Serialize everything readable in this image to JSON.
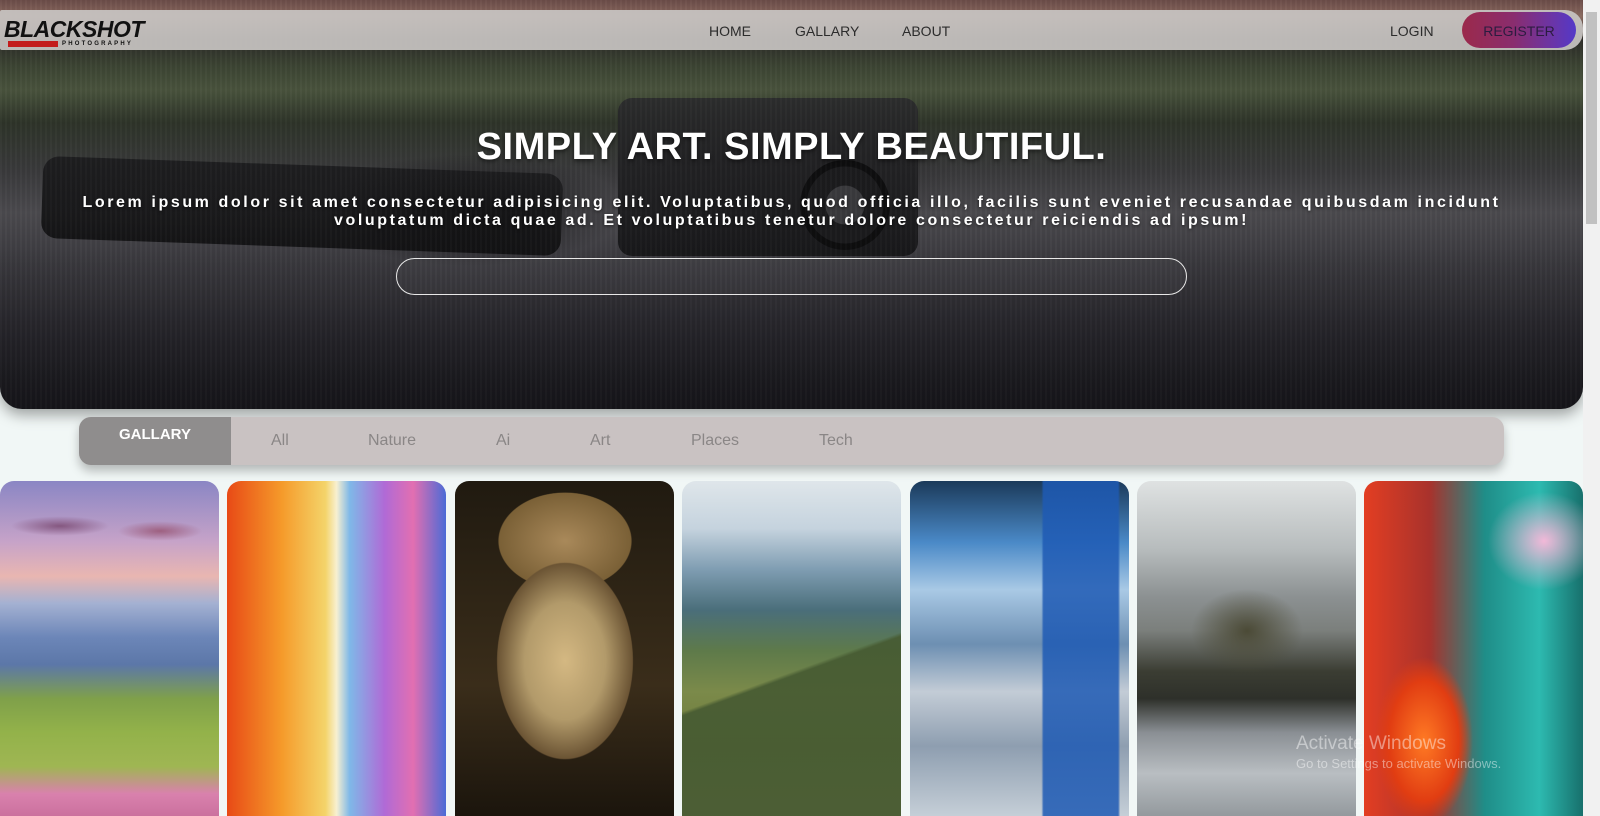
{
  "brand": {
    "logo_text": "BLACKSHOT",
    "logo_subtext": "PHOTOGRAPHY",
    "accent_red": "#c31c1c"
  },
  "nav": {
    "links": [
      "HOME",
      "GALLARY",
      "ABOUT"
    ],
    "login_label": "LOGIN",
    "register_label": "REGISTER"
  },
  "hero": {
    "title": "SIMPLY ART. SIMPLY BEAUTIFUL.",
    "description": "Lorem ipsum dolor sit amet consectetur adipisicing elit. Voluptatibus, quod officia illo, facilis sunt eveniet recusandae quibusdam incidunt voluptatum dicta quae ad. Et voluptatibus tenetur dolore consectetur reiciendis ad ipsum!",
    "search_value": "",
    "search_placeholder": ""
  },
  "filters": {
    "active_label": "GALLARY",
    "buttons": [
      "All",
      "Nature",
      "Ai",
      "Art",
      "Places",
      "Tech"
    ]
  },
  "gallery": {
    "items": [
      {
        "name": "mountain-meadow-sunset"
      },
      {
        "name": "human-and-robot-painting"
      },
      {
        "name": "bronze-mask-sculpture"
      },
      {
        "name": "mountain-ruins-tablet"
      },
      {
        "name": "robot-warehouse-drones"
      },
      {
        "name": "lone-tree-lake"
      },
      {
        "name": "fiery-teal-tree"
      }
    ]
  },
  "os_watermark": {
    "title": "Activate Windows",
    "subtitle": "Go to Settings to activate Windows."
  }
}
